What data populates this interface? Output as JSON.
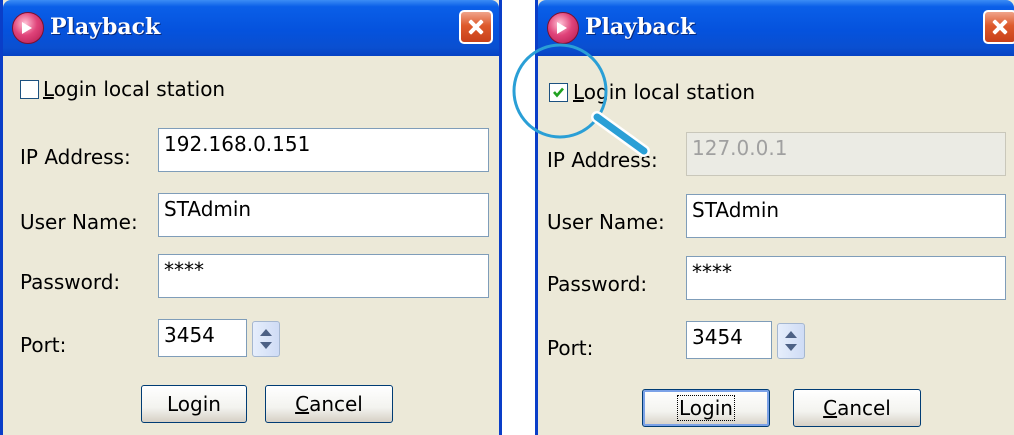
{
  "dialogs": [
    {
      "title": "Playback",
      "login_local_station": {
        "label": "Login local station",
        "checked": false
      },
      "ip_address": {
        "label": "IP Address:",
        "value": "192.168.0.151",
        "disabled": false
      },
      "user_name": {
        "label": "User Name:",
        "value": "STAdmin"
      },
      "password": {
        "label": "Password:",
        "value": "****"
      },
      "port": {
        "label": "Port:",
        "value": "3454"
      },
      "buttons": {
        "login": "Login",
        "cancel": "Cancel"
      }
    },
    {
      "title": "Playback",
      "login_local_station": {
        "label": "Login local station",
        "checked": true
      },
      "ip_address": {
        "label": "IP Address:",
        "value": "127.0.0.1",
        "disabled": true
      },
      "user_name": {
        "label": "User Name:",
        "value": "STAdmin"
      },
      "password": {
        "label": "Password:",
        "value": "****"
      },
      "port": {
        "label": "Port:",
        "value": "3454"
      },
      "buttons": {
        "login": "Login",
        "cancel": "Cancel"
      }
    }
  ],
  "colors": {
    "titlebar": "#0552dd",
    "dialog_bg": "#ece9d8",
    "checkmark": "#21a121",
    "highlight_circle": "#2a9fd6"
  },
  "icons": [
    "playback-app-icon",
    "close-icon",
    "checkbox-checked-icon",
    "spinner-arrows-icon",
    "magnifier-icon"
  ]
}
